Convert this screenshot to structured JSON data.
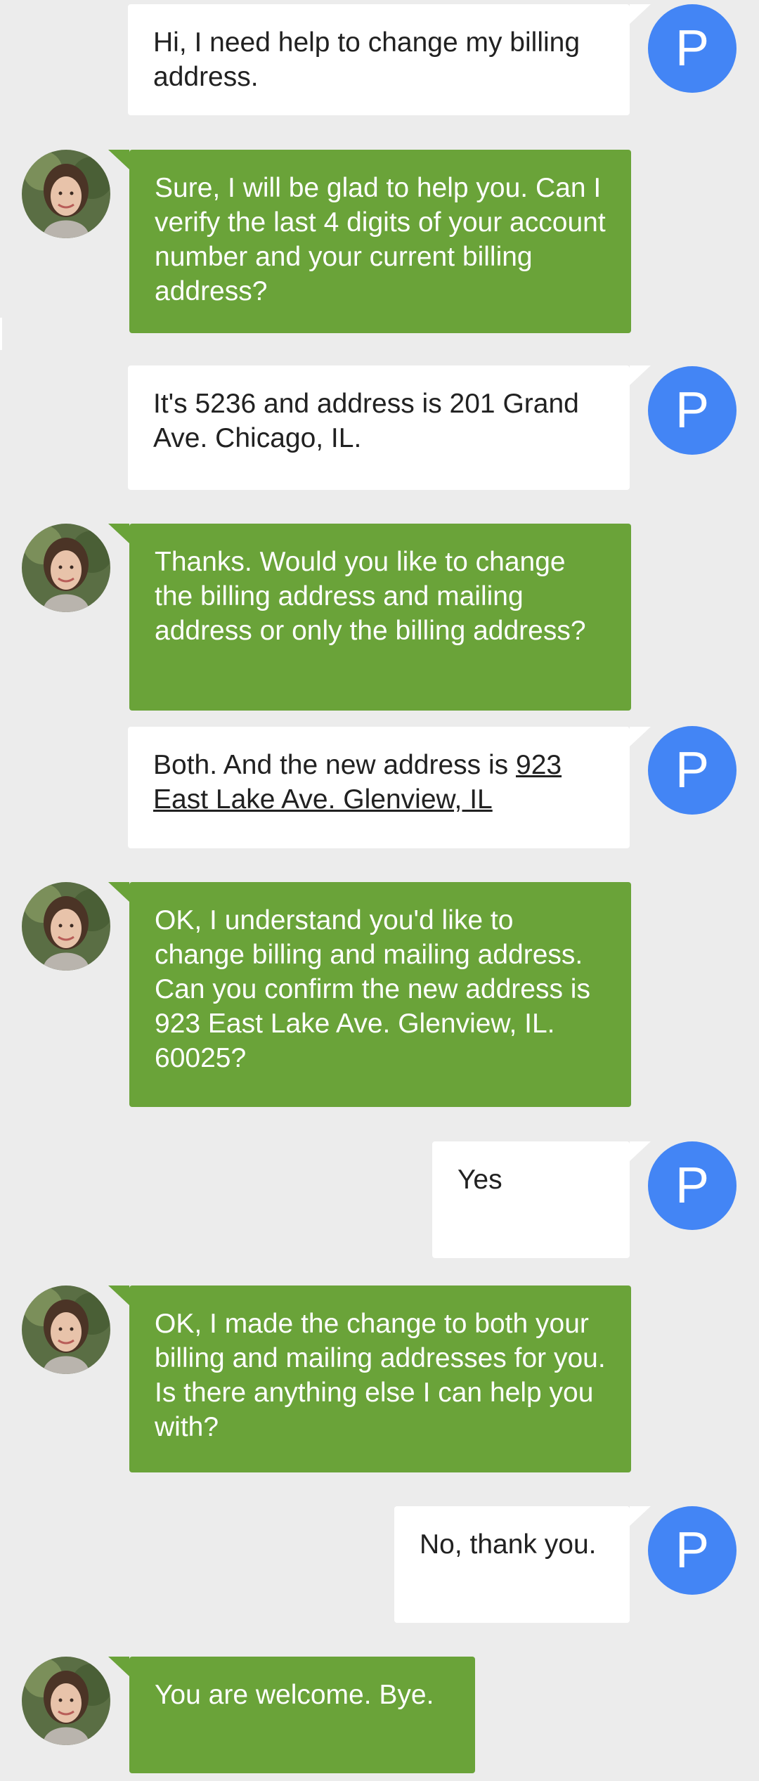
{
  "user_avatar_letter": "P",
  "messages": [
    {
      "sender": "user",
      "text": "Hi, I need help to change my billing address."
    },
    {
      "sender": "agent",
      "text": "Sure, I will be glad to help you. Can I verify the last 4 digits of your account number and your current billing address?"
    },
    {
      "sender": "user",
      "text": "It's 5236 and address is 201 Grand Ave. Chicago, IL."
    },
    {
      "sender": "agent",
      "text": "Thanks. Would you like to change the billing address and mailing address or only the billing address?"
    },
    {
      "sender": "user",
      "text_before_link": "Both. And the new address is ",
      "link_text": "923 East Lake Ave. Glenview, IL"
    },
    {
      "sender": "agent",
      "text": "OK, I understand you'd like to change billing and mailing address. Can you confirm the new address is 923 East Lake Ave. Glenview, IL. 60025?"
    },
    {
      "sender": "user",
      "text": "Yes"
    },
    {
      "sender": "agent",
      "text": "OK, I made the change to both your billing and mailing addresses for you. Is there anything else I can help you with?"
    },
    {
      "sender": "user",
      "text": "No, thank you."
    },
    {
      "sender": "agent",
      "text": "You are welcome. Bye."
    }
  ],
  "colors": {
    "background": "#ececec",
    "user_bubble": "#ffffff",
    "agent_bubble": "#6aa339",
    "user_avatar": "#4385f5"
  },
  "icons": {
    "user_avatar": "letter-avatar",
    "agent_avatar": "agent-photo"
  }
}
